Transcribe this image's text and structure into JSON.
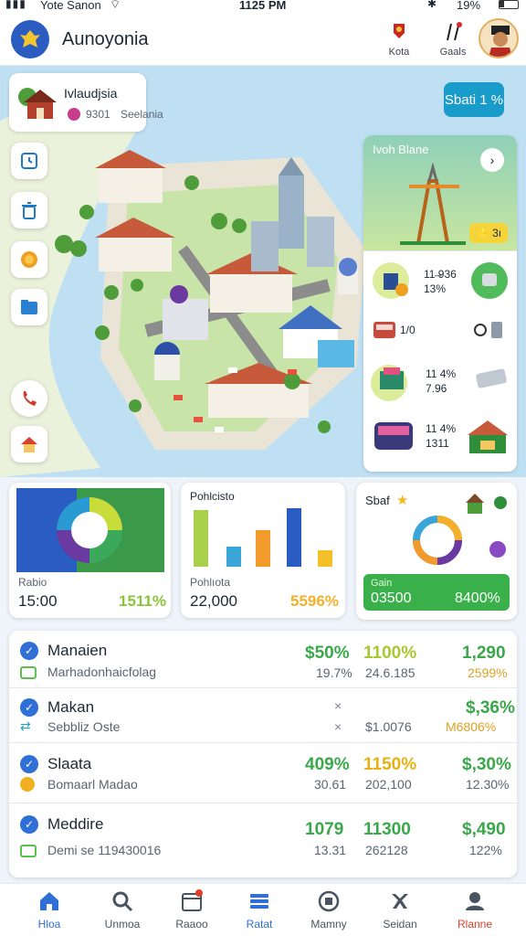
{
  "status": {
    "signal": "Yote Sanon",
    "time": "1125 PM",
    "battery": "19%"
  },
  "app": {
    "title": "Aunoyonia",
    "btn_kota": "Kota",
    "btn_gaals": "Gaals"
  },
  "location_card": {
    "title": "Ivlaudjsia",
    "code": "9301",
    "sub": "Seelania"
  },
  "map_action": "Sbati 1 %",
  "right_panel": {
    "feature_title": "Ivoh Blane",
    "feature_badge": "⭐ 3ı",
    "items": [
      {
        "line1": "11 ̶936",
        "line2": "13%"
      },
      {
        "line1": "1/0",
        "line2": ""
      },
      {
        "line1": "11 4%",
        "line2": "7.96"
      },
      {
        "line1": "11 4%",
        "line2": "1311"
      }
    ]
  },
  "stat_cards": [
    {
      "label": "Rabio",
      "value": "15:00",
      "pct": "1511%"
    },
    {
      "label": "Pohlıota",
      "title": "Pohlcisto",
      "value": "22,000",
      "pct": "5596%"
    },
    {
      "label": "Gain",
      "title": "Sbaf",
      "value": "03500",
      "pct": "8400%"
    }
  ],
  "table_rows": [
    {
      "name": "Manaien",
      "sub": "Marhadonhaicfolag",
      "c1": "$50%",
      "c2": "1100%",
      "c3": "1,290",
      "s1": "19.7%",
      "s2": "24.6.185",
      "s3": "2599%"
    },
    {
      "name": "Makan",
      "sub": "Sebbliz Oste",
      "c1": "×",
      "c2": "",
      "c3": "$,36%",
      "s1": "×",
      "s2": "$1.0076",
      "s3": "M6806%"
    },
    {
      "name": "Slaata",
      "sub": "Bomaarl Madao",
      "c1": "409%",
      "c2": "1150%",
      "c3": "$,30%",
      "s1": "30.61",
      "s2": "202,100",
      "s3": "12.30%"
    },
    {
      "name": "Meddire",
      "sub": "Demi se 119430016",
      "c1": "1079",
      "c2": "11300",
      "c3": "$,490",
      "s1": "13.31",
      "s2": "262128",
      "s3": "122%"
    }
  ],
  "nav": [
    "Hloa",
    "Unmoa",
    "Raaoo",
    "Ratat",
    "Mamny",
    "Seidan",
    "Rlanne"
  ],
  "colors": {
    "accent": "#2f6fd6",
    "green": "#3aa84a",
    "yellow": "#e0b400",
    "teal": "#1aa0c2"
  }
}
